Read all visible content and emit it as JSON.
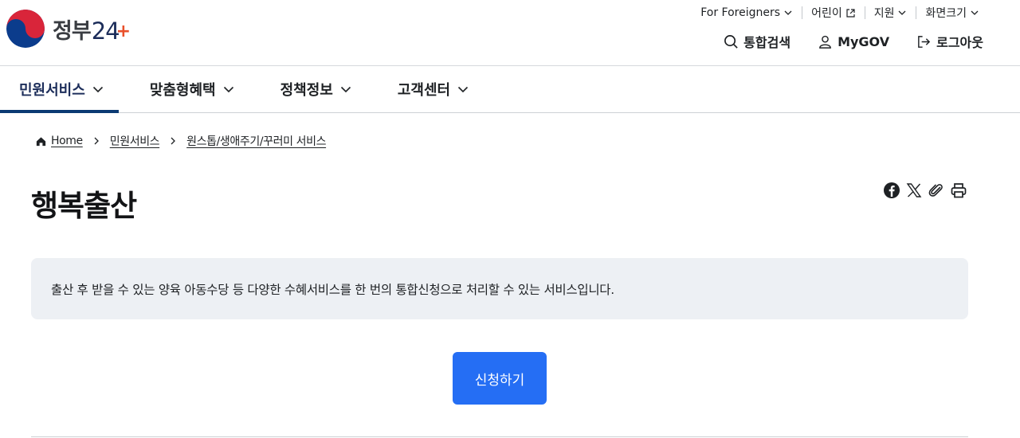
{
  "header": {
    "logo_text": "정부",
    "logo_number": "24",
    "logo_plus": "+",
    "utility": [
      {
        "label": "For Foreigners",
        "icon": "chevron-down-icon"
      },
      {
        "label": "어린이",
        "icon": "external-link-icon"
      },
      {
        "label": "지원",
        "icon": "chevron-down-icon"
      },
      {
        "label": "화면크기",
        "icon": "chevron-down-icon"
      }
    ],
    "actions": {
      "search": "통합검색",
      "mygov": "MyGOV",
      "logout": "로그아웃"
    }
  },
  "nav": {
    "items": [
      {
        "label": "민원서비스",
        "active": true
      },
      {
        "label": "맞춤형혜택"
      },
      {
        "label": "정책정보"
      },
      {
        "label": "고객센터"
      }
    ]
  },
  "breadcrumb": {
    "home": "Home",
    "level1": "민원서비스",
    "level2": "원스톱/생애주기/꾸러미 서비스"
  },
  "page": {
    "title": "행복출산",
    "description": "출산 후 받을 수 있는 양육 아동수당 등 다양한 수혜서비스를 한 번의 통합신청으로 처리할 수 있는 서비스입니다.",
    "apply_label": "신청하기"
  },
  "share": [
    "facebook-icon",
    "x-icon",
    "attach-link-icon",
    "print-icon"
  ],
  "colors": {
    "primary": "#256ef4",
    "nav_active": "#0b3a73",
    "desc_bg": "#edf0f4"
  }
}
